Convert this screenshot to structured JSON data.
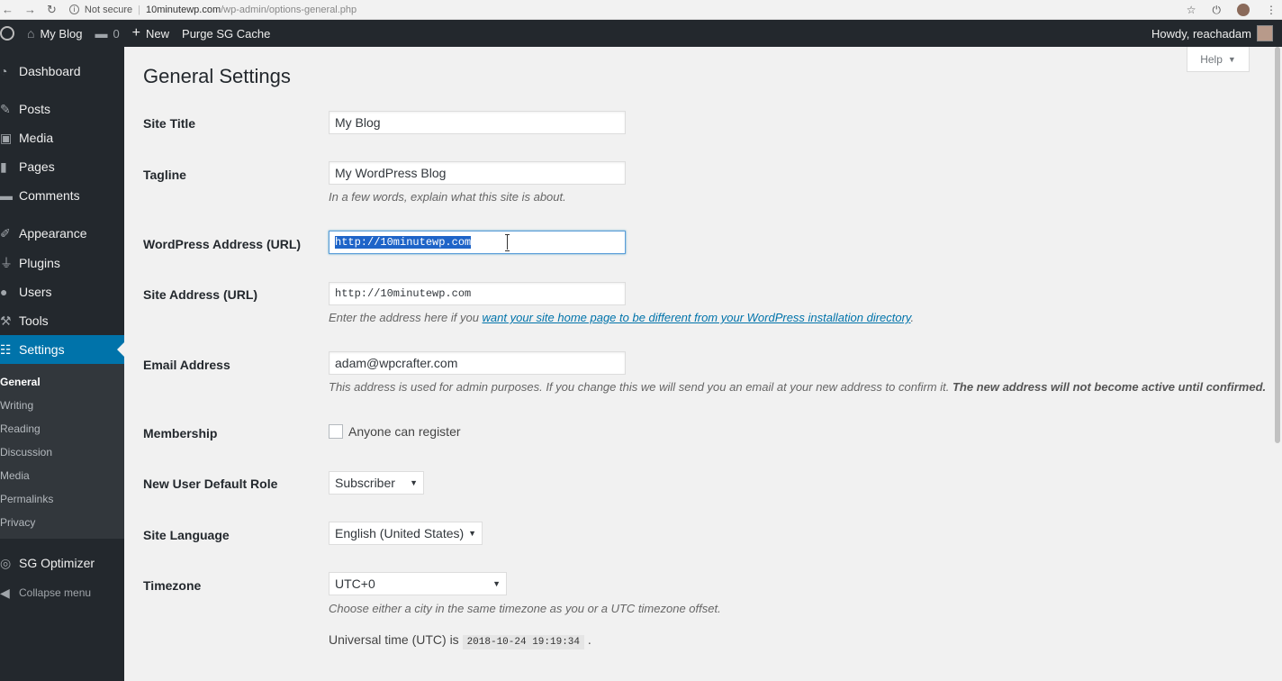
{
  "browser": {
    "security": "Not secure",
    "url_host": "10minutewp.com",
    "url_path": "/wp-admin/options-general.php",
    "icons": [
      "back-arrow-icon",
      "forward-arrow-icon",
      "reload-icon",
      "info-icon",
      "star-icon",
      "power-icon",
      "profile-icon",
      "menu-dots-icon"
    ]
  },
  "admin_bar": {
    "site_name": "My Blog",
    "comments_count": "0",
    "new_label": "New",
    "purge_label": "Purge SG Cache",
    "howdy": "Howdy, reachadam"
  },
  "sidebar": {
    "items": [
      {
        "label": "Dashboard",
        "icon": "dashboard-icon"
      },
      {
        "label": "Posts",
        "icon": "pin-icon"
      },
      {
        "label": "Media",
        "icon": "media-icon"
      },
      {
        "label": "Pages",
        "icon": "pages-icon"
      },
      {
        "label": "Comments",
        "icon": "comment-icon"
      },
      {
        "label": "Appearance",
        "icon": "brush-icon"
      },
      {
        "label": "Plugins",
        "icon": "plug-icon"
      },
      {
        "label": "Users",
        "icon": "user-icon"
      },
      {
        "label": "Tools",
        "icon": "wrench-icon"
      },
      {
        "label": "Settings",
        "icon": "settings-icon"
      }
    ],
    "submenu": [
      "General",
      "Writing",
      "Reading",
      "Discussion",
      "Media",
      "Permalinks",
      "Privacy"
    ],
    "sg_optimizer": "SG Optimizer",
    "collapse": "Collapse menu"
  },
  "page": {
    "title": "General Settings",
    "help": "Help"
  },
  "form": {
    "site_title": {
      "label": "Site Title",
      "value": "My Blog"
    },
    "tagline": {
      "label": "Tagline",
      "value": "My WordPress Blog",
      "desc": "In a few words, explain what this site is about."
    },
    "wp_address": {
      "label": "WordPress Address (URL)",
      "value": "http://10minutewp.com"
    },
    "site_address": {
      "label": "Site Address (URL)",
      "value": "http://10minutewp.com",
      "desc_pre": "Enter the address here if you ",
      "desc_link": "want your site home page to be different from your WordPress installation directory",
      "desc_post": "."
    },
    "email": {
      "label": "Email Address",
      "value": "adam@wpcrafter.com",
      "desc_pre": "This address is used for admin purposes. If you change this we will send you an email at your new address to confirm it. ",
      "desc_bold": "The new address will not become active until confirmed."
    },
    "membership": {
      "label": "Membership",
      "checkbox_label": "Anyone can register",
      "checked": false
    },
    "default_role": {
      "label": "New User Default Role",
      "value": "Subscriber"
    },
    "language": {
      "label": "Site Language",
      "value": "English (United States)"
    },
    "timezone": {
      "label": "Timezone",
      "value": "UTC+0",
      "desc": "Choose either a city in the same timezone as you or a UTC timezone offset.",
      "utc_pre": "Universal time (UTC) is ",
      "utc_time": "2018-10-24 19:19:34",
      "utc_post": " ."
    }
  },
  "colors": {
    "accent": "#0073aa",
    "admin_dark": "#23282d"
  }
}
